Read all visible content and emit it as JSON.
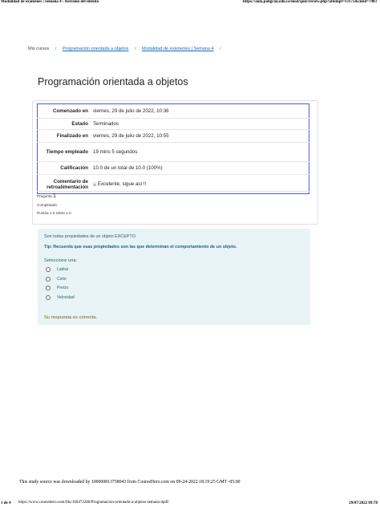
{
  "print_header": {
    "title": "Modalidad de exámenes | Semana 4 : Revisión del intento",
    "url": "https://aula.poligran.edu.co/mod/quiz/review.php?attempt=13175&cmid=7983"
  },
  "breadcrumb": {
    "items": [
      "Mis cursos",
      "Programación orientada a objetos",
      "Modalidad de exámenes | Semana 4"
    ],
    "separator": "/"
  },
  "page": {
    "title": "Programación orientada a objetos"
  },
  "summary": {
    "rows": [
      {
        "label": "Comenzado en",
        "value": "viernes, 29 de julio de 2022, 10:36"
      },
      {
        "label": "Estado",
        "value": "Terminados"
      },
      {
        "label": "Finalizado en",
        "value": "viernes, 29 de julio de 2022, 10:55"
      },
      {
        "label": "Tiempo empleado",
        "value": "19 mins 5 segundos"
      },
      {
        "label": "Calificación",
        "value": "10.0 de un total de 10.0 (100%)"
      },
      {
        "label": "Comentario de retroalimentación",
        "value": "¡¡ Excelente, sigue así !!"
      }
    ]
  },
  "question_info": {
    "label": "Pregunta",
    "number": "1",
    "state": "Completada",
    "score": "Puntúa 1.0 sobre 1.0"
  },
  "question": {
    "text": "Son todas propiedades de un objeto EXCEPTO.",
    "tip": "Tip: Recuerda que esas propiedades son las que determinan el comportamiento de un objeto.",
    "prompt": "Seleccione una:",
    "options": [
      "Ladrar",
      "Color",
      "Precio",
      "Velocidad"
    ]
  },
  "feedback": {
    "text": "Su respuesta es correcta."
  },
  "footer": {
    "source": "This study source was downloaded by 100000813758043 from CourseHero.com on 09-24-2022 18:19:25 GMT -05:00",
    "url": "https://www.coursehero.com/file/160472280/Programacion-orientada-a-objetos-semana-4pdf/",
    "page_indicator": "1 de 4",
    "date": "29/07/2022 09:78"
  }
}
